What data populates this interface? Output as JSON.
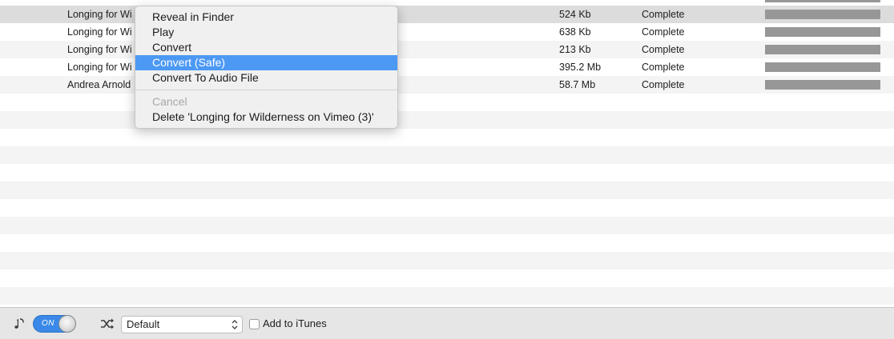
{
  "rows": [
    {
      "name": "Longing for Wi",
      "size": "524 Kb",
      "status": "Complete",
      "progress": 1.0
    },
    {
      "name": "Longing for Wi",
      "size": "638 Kb",
      "status": "Complete",
      "progress": 1.0
    },
    {
      "name": "Longing for Wi",
      "size": "213 Kb",
      "status": "Complete",
      "progress": 1.0
    },
    {
      "name": "Longing for Wi",
      "size": "395.2 Mb",
      "status": "Complete",
      "progress": 1.0
    },
    {
      "name": "Andrea Arnold",
      "size": "58.7 Mb",
      "status": "Complete",
      "progress": 1.0
    }
  ],
  "context_menu": {
    "items": [
      {
        "label": "Reveal in Finder"
      },
      {
        "label": "Play"
      },
      {
        "label": "Convert"
      },
      {
        "label": "Convert (Safe)"
      },
      {
        "label": "Convert To Audio File"
      }
    ],
    "cancel_label": "Cancel",
    "delete_label": "Delete 'Longing for Wilderness on Vimeo (3)'"
  },
  "bottom_bar": {
    "toggle_label": "ON",
    "preset_value": "Default",
    "add_to_itunes_label": "Add to iTunes",
    "add_to_itunes_checked": false
  },
  "colors": {
    "highlight": "#4c99f4",
    "toggle_on": "#3a89e8",
    "progress_fill": "#979797"
  },
  "icons": [
    "audio-note-icon",
    "shuffle-icon",
    "select-arrows-icon"
  ]
}
